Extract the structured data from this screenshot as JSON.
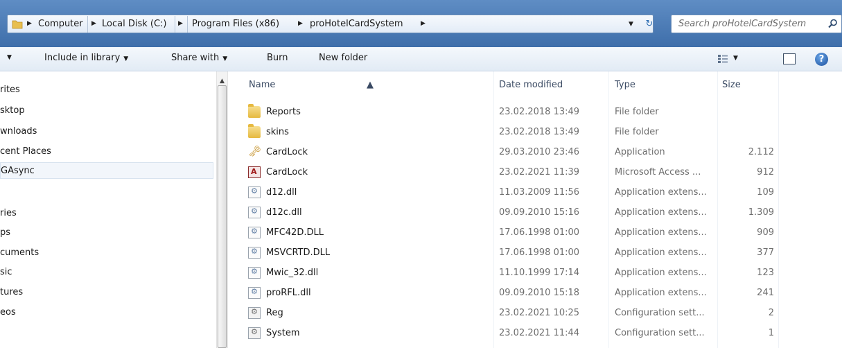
{
  "address": {
    "breadcrumbs": [
      "Computer",
      "Local Disk (C:)",
      "Program Files (x86)",
      "proHotelCardSystem"
    ],
    "search_placeholder": "Search proHotelCardSystem"
  },
  "toolbar": {
    "organize_caret": "▼",
    "include_in_library": "Include in library",
    "share_with": "Share with",
    "burn": "Burn",
    "new_folder": "New folder"
  },
  "nav": {
    "items": [
      "rites",
      "sktop",
      "wnloads",
      "cent Places",
      "GAsync",
      "ries",
      "ps",
      "cuments",
      "sic",
      "tures",
      "eos"
    ]
  },
  "columns": {
    "name": "Name",
    "date": "Date modified",
    "type": "Type",
    "size": "Size"
  },
  "files": [
    {
      "icon": "folder-icon",
      "name": "Reports",
      "date": "23.02.2018 13:49",
      "type": "File folder",
      "size": ""
    },
    {
      "icon": "folder-icon",
      "name": "skins",
      "date": "23.02.2018 13:49",
      "type": "File folder",
      "size": ""
    },
    {
      "icon": "application-icon",
      "name": "CardLock",
      "date": "29.03.2010 23:46",
      "type": "Application",
      "size": "2.112"
    },
    {
      "icon": "access-db-icon",
      "name": "CardLock",
      "date": "23.02.2021 11:39",
      "type": "Microsoft Access ...",
      "size": "912"
    },
    {
      "icon": "dll-icon",
      "name": "d12.dll",
      "date": "11.03.2009 11:56",
      "type": "Application extens...",
      "size": "109"
    },
    {
      "icon": "dll-icon",
      "name": "d12c.dll",
      "date": "09.09.2010 15:16",
      "type": "Application extens...",
      "size": "1.309"
    },
    {
      "icon": "dll-icon",
      "name": "MFC42D.DLL",
      "date": "17.06.1998 01:00",
      "type": "Application extens...",
      "size": "909"
    },
    {
      "icon": "dll-icon",
      "name": "MSVCRTD.DLL",
      "date": "17.06.1998 01:00",
      "type": "Application extens...",
      "size": "377"
    },
    {
      "icon": "dll-icon",
      "name": "Mwic_32.dll",
      "date": "11.10.1999 17:14",
      "type": "Application extens...",
      "size": "123"
    },
    {
      "icon": "dll-icon",
      "name": "proRFL.dll",
      "date": "09.09.2010 15:18",
      "type": "Application extens...",
      "size": "241"
    },
    {
      "icon": "config-settings-icon",
      "name": "Reg",
      "date": "23.02.2021 10:25",
      "type": "Configuration sett...",
      "size": "2"
    },
    {
      "icon": "config-settings-icon",
      "name": "System",
      "date": "23.02.2021 11:44",
      "type": "Configuration sett...",
      "size": "1"
    }
  ]
}
